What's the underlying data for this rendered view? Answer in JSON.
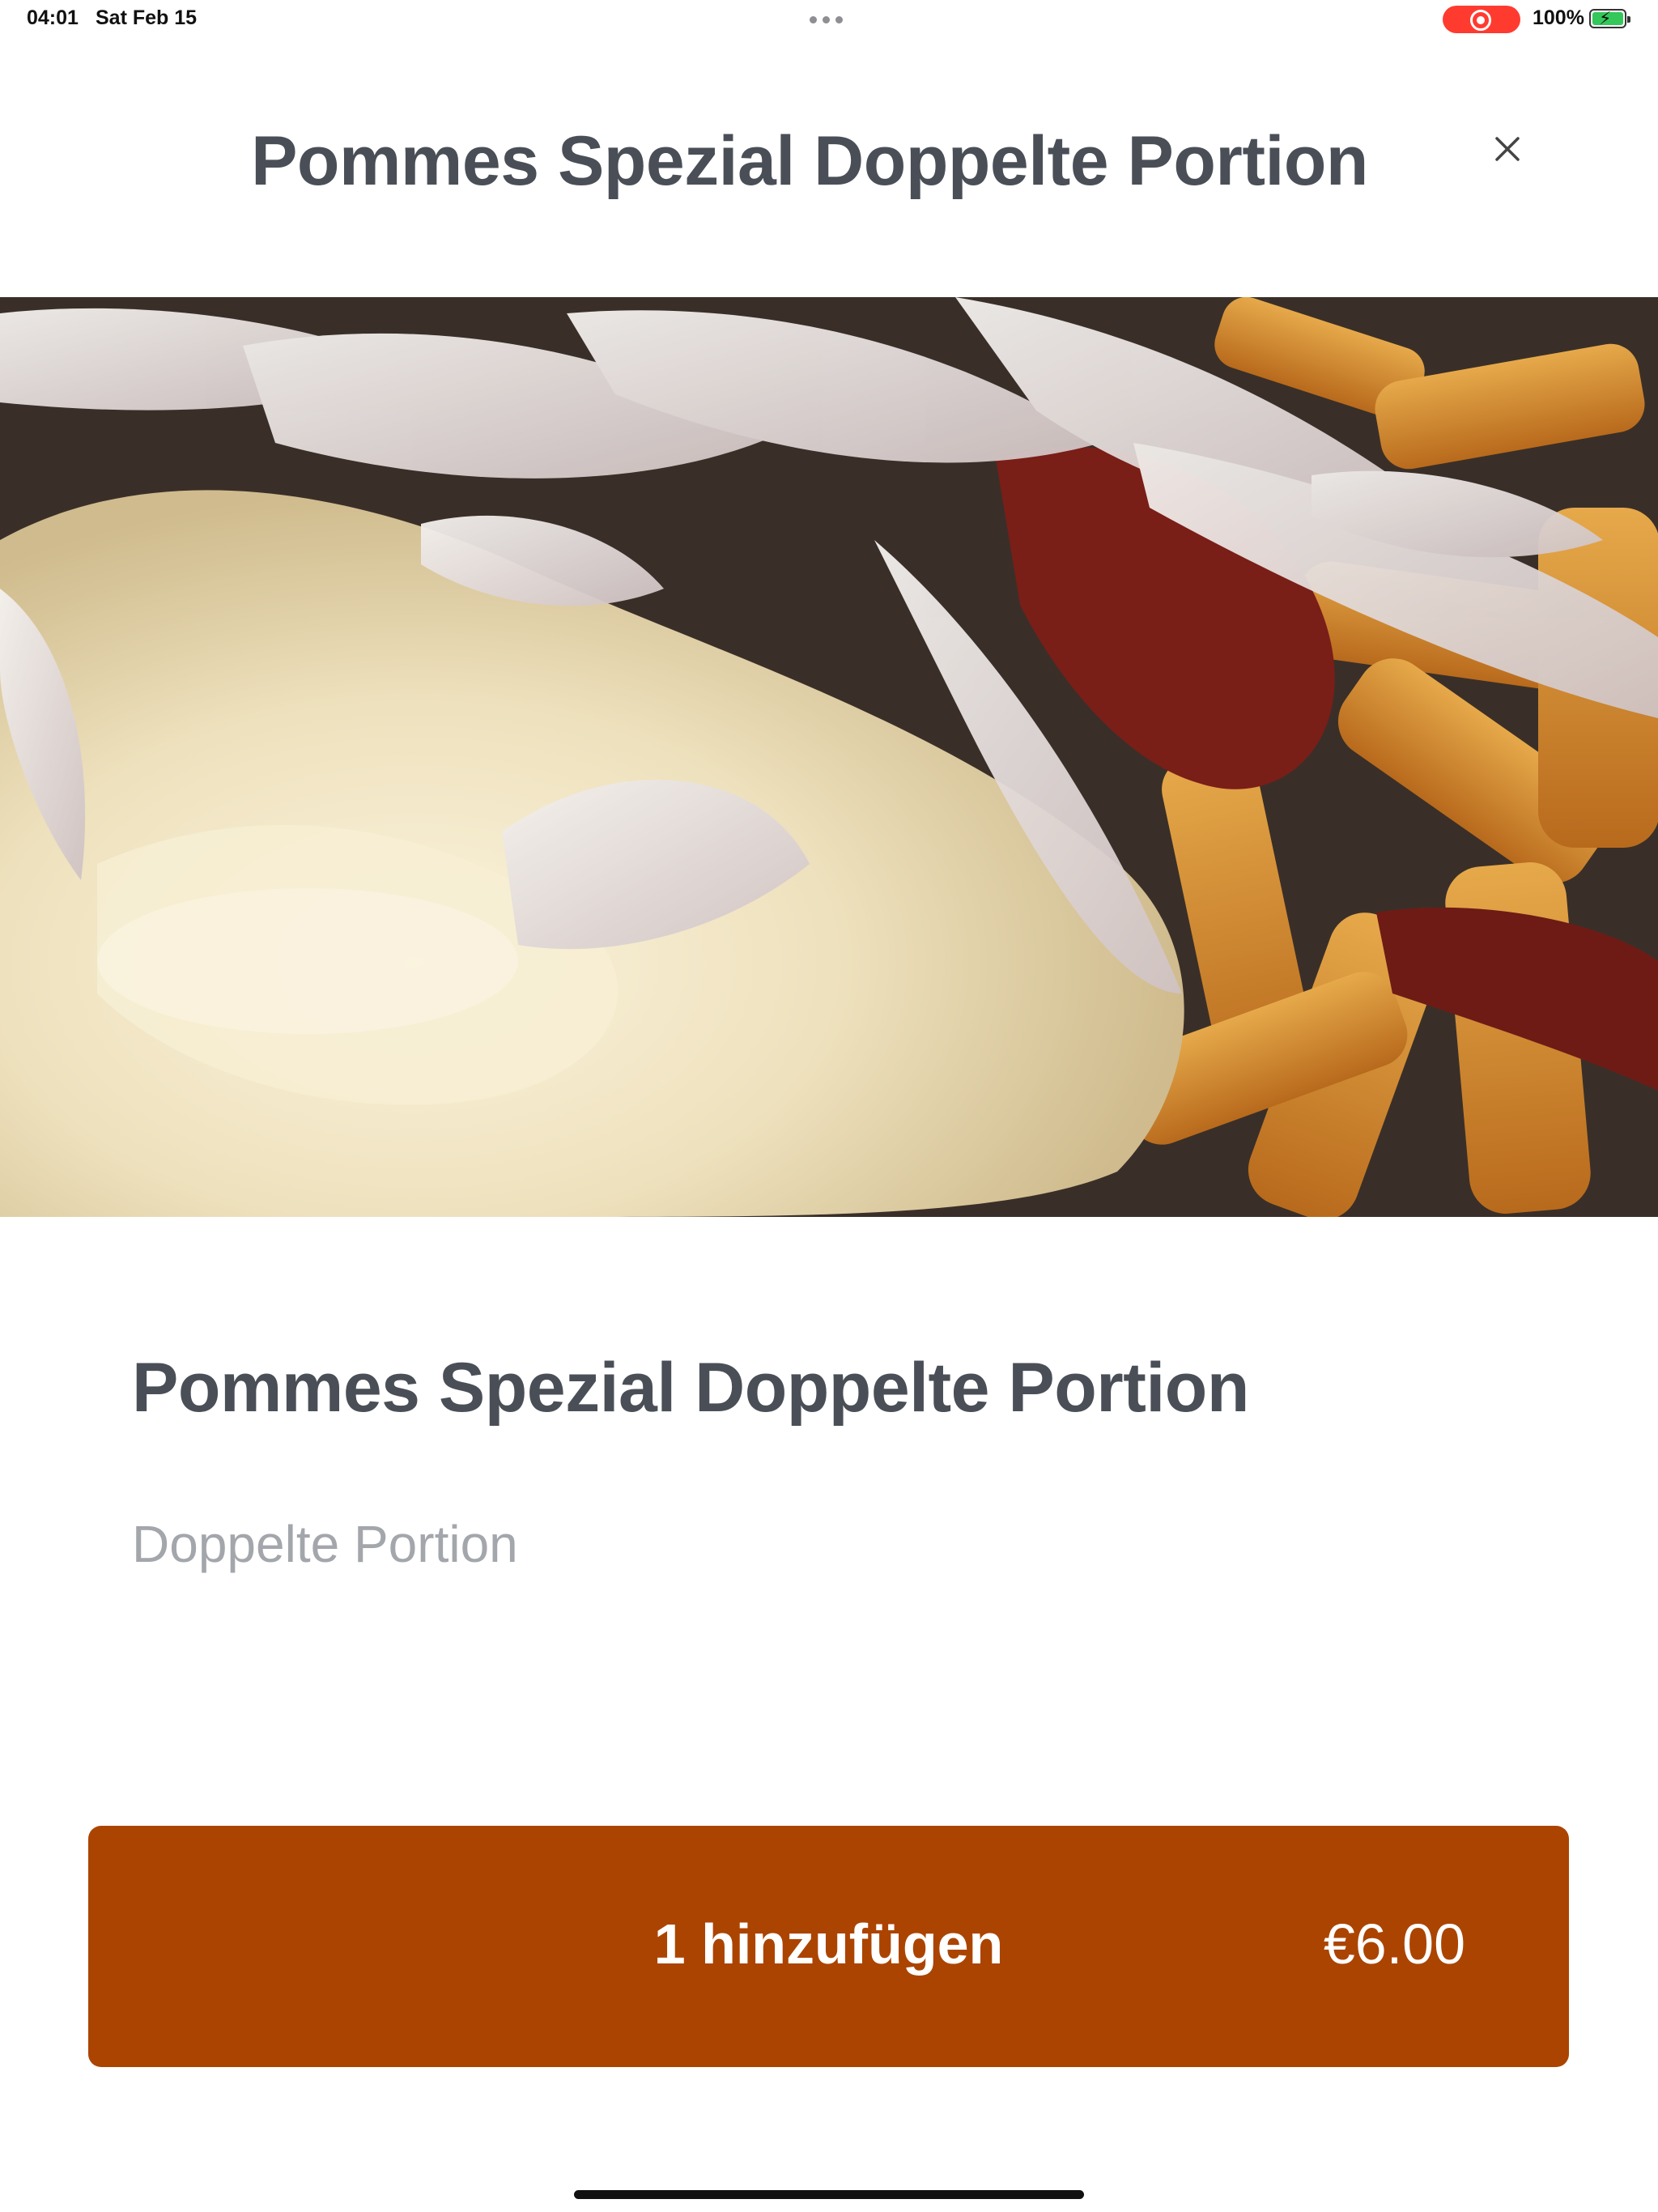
{
  "status_bar": {
    "time": "04:01",
    "date": "Sat Feb 15",
    "battery": "100%"
  },
  "header": {
    "title": "Pommes Spezial Doppelte Portion"
  },
  "product": {
    "name": "Pommes Spezial Doppelte Portion",
    "description": "Doppelte Portion"
  },
  "add_button": {
    "label": "1 hinzufügen",
    "price": "€6.00"
  },
  "colors": {
    "accent": "#ab4400",
    "title_text": "#4a4f57",
    "muted_text": "#a3a6ab",
    "recording": "#ff3b30",
    "battery": "#34c759"
  },
  "icons": [
    "close-icon",
    "recording-icon",
    "battery-icon",
    "more-dots-icon"
  ]
}
